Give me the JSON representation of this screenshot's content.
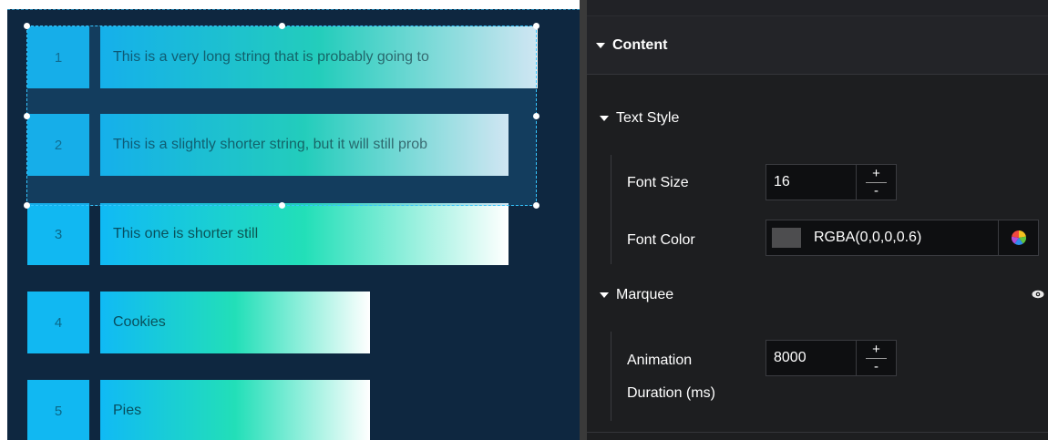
{
  "canvas": {
    "rows": [
      {
        "index": "1",
        "text": "This is a very long string that is probably going to"
      },
      {
        "index": "2",
        "text": "This is a slightly shorter string, but it will still prob"
      },
      {
        "index": "3",
        "text": "This one is shorter still"
      },
      {
        "index": "4",
        "text": "Cookies"
      },
      {
        "index": "5",
        "text": "Pies"
      }
    ]
  },
  "panel": {
    "content_header": "Content",
    "text_style": {
      "title": "Text Style",
      "font_size_label": "Font Size",
      "font_size_value": "16",
      "font_color_label": "Font Color",
      "font_color_value": "RGBA(0,0,0,0.6)"
    },
    "marquee": {
      "title": "Marquee",
      "animation_label_line1": "Animation",
      "animation_label_line2": "Duration (ms)",
      "animation_value": "8000"
    },
    "stepper": {
      "plus": "+",
      "minus": "-"
    }
  },
  "colors": {
    "canvas_bg": "#0e2740",
    "number_box": "#11b8f2",
    "bar_gradient": [
      "#10baf5",
      "#22dfb8",
      "#ffffff"
    ],
    "panel_bg": "#1d1e20",
    "selection_border": "#36c6ff"
  },
  "icons": {
    "caret": "caret-down-icon",
    "color_picker": "color-wheel-icon",
    "visibility": "eye-icon"
  }
}
